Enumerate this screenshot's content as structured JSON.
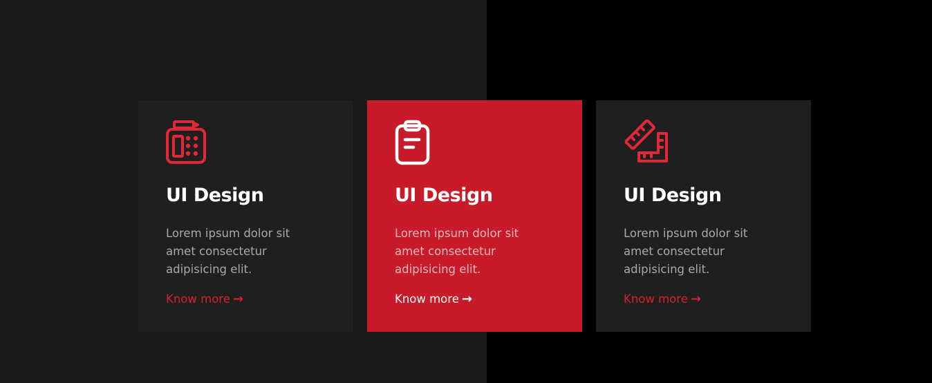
{
  "colors": {
    "page_left_bg": "#181818",
    "page_right_bg": "#000000",
    "card_bg": "#1f1f1f",
    "card_active_bg": "#c81b29",
    "accent": "#e22838"
  },
  "cards": [
    {
      "icon": "calculator-icon",
      "title": "UI Design",
      "text": "Lorem ipsum dolor sit amet consectetur adipisicing elit.",
      "link_label": "Know more",
      "arrow": "→"
    },
    {
      "icon": "clipboard-icon",
      "title": "UI Design",
      "text": "Lorem ipsum dolor sit amet consectetur adipisicing elit.",
      "link_label": "Know more",
      "arrow": "→"
    },
    {
      "icon": "rulers-icon",
      "title": "UI Design",
      "text": "Lorem ipsum dolor sit amet consectetur adipisicing elit.",
      "link_label": "Know more",
      "arrow": "→"
    }
  ]
}
